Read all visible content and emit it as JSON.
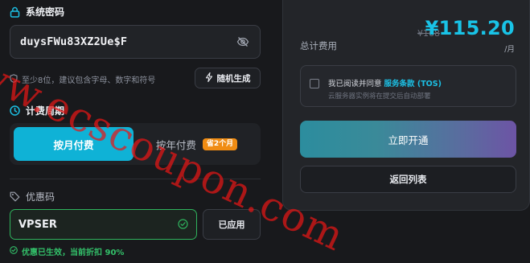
{
  "password_section": {
    "title": "系统密码",
    "value": "duysFWu83XZ2Ue$F",
    "hint": "至少8位，建议包含字母、数字和符号",
    "generate_label": "随机生成",
    "toggle_icon": "eye-off-icon"
  },
  "billing_section": {
    "title": "计费周期",
    "options": [
      {
        "label": "按月付费",
        "active": true
      },
      {
        "label": "按年付费",
        "badge": "省2个月",
        "active": false
      }
    ]
  },
  "coupon_section": {
    "title": "优惠码",
    "value": "VPSER",
    "apply_label": "已应用",
    "status": "优惠已生效，当前折扣 90%"
  },
  "summary": {
    "total_label": "总计费用",
    "old_price": "¥168",
    "price": "¥115.20",
    "per": "/月",
    "tos_prefix": "我已阅读并同意",
    "tos_link": "服务条款 (TOS)",
    "tos_note": "云服务器实例将在提交后自动部署",
    "submit_label": "立即开通",
    "back_label": "返回列表",
    "tos_checked": false
  },
  "watermark": "www.ecscoupon.com",
  "colors": {
    "accent": "#0fb2d6",
    "success": "#2fb35d",
    "badge": "#f08c13",
    "price": "#19c3e6"
  }
}
